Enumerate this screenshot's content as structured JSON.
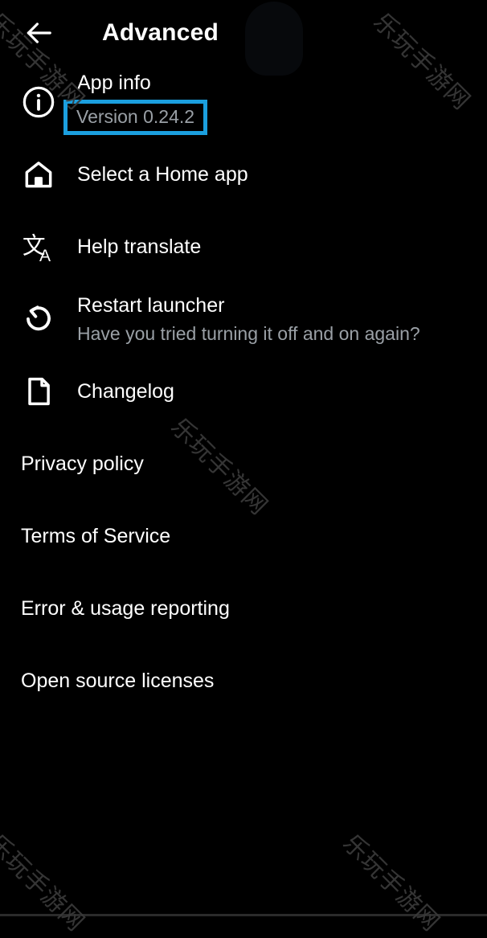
{
  "appbar": {
    "back_icon": "arrow-left-icon",
    "title": "Advanced"
  },
  "watermark": {
    "text": "乐玩手游网"
  },
  "highlight": {
    "color": "#1b9fdf",
    "target": "app-info-version"
  },
  "list": {
    "icon_rows": [
      {
        "icon": "info-circle-icon",
        "title": "App info",
        "subtitle": "Version 0.24.2",
        "highlighted": true
      },
      {
        "icon": "home-icon",
        "title": "Select a Home app",
        "subtitle": "",
        "highlighted": false
      },
      {
        "icon": "translate-icon",
        "title": "Help translate",
        "subtitle": "",
        "highlighted": false
      },
      {
        "icon": "restart-icon",
        "title": "Restart launcher",
        "subtitle": "Have you tried turning it off and on again?",
        "highlighted": false
      },
      {
        "icon": "document-icon",
        "title": "Changelog",
        "subtitle": "",
        "highlighted": false
      }
    ],
    "plain_rows": [
      {
        "title": "Privacy policy"
      },
      {
        "title": "Terms of Service"
      },
      {
        "title": "Error & usage reporting"
      },
      {
        "title": "Open source licenses"
      }
    ]
  }
}
